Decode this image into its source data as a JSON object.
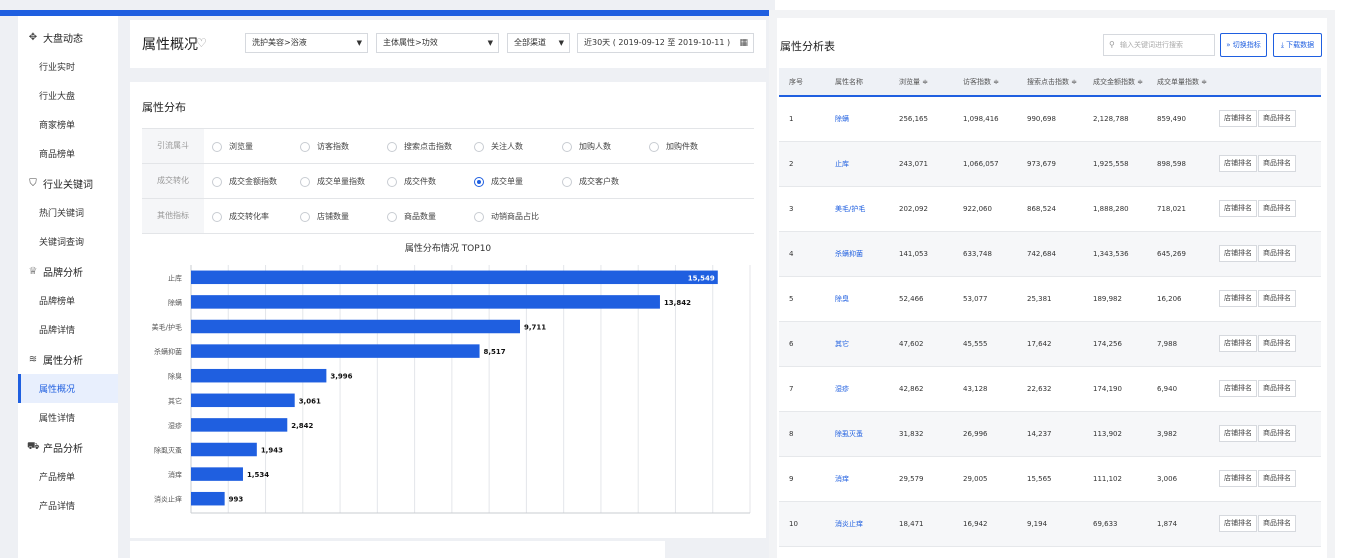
{
  "sidebar": {
    "groups": [
      {
        "label": "大盘动态",
        "icon": "pin-icon",
        "items": [
          "行业实时",
          "行业大盘",
          "商家榜单",
          "商品榜单"
        ]
      },
      {
        "label": "行业关键词",
        "icon": "shield-icon",
        "items": [
          "热门关键词",
          "关键词查询"
        ]
      },
      {
        "label": "品牌分析",
        "icon": "crown-icon",
        "items": [
          "品牌榜单",
          "品牌详情"
        ]
      },
      {
        "label": "属性分析",
        "icon": "bars-icon",
        "items": [
          "属性概况",
          "属性详情"
        ]
      },
      {
        "label": "产品分析",
        "icon": "cart-icon",
        "items": [
          "产品榜单",
          "产品详情"
        ]
      }
    ],
    "active_item": "属性概况"
  },
  "header": {
    "title": "属性概况",
    "category_select": "洗护美容>浴液",
    "attribute_select": "主体属性>功效",
    "channel_select": "全部渠道",
    "date_range": "近30天 ( 2019-09-12 至 2019-10-11 )"
  },
  "distribution": {
    "title": "属性分布",
    "rows": [
      {
        "label": "引流属斗",
        "options": [
          "浏览量",
          "访客指数",
          "搜索点击指数",
          "关注人数",
          "加购人数",
          "加购件数"
        ]
      },
      {
        "label": "成交转化",
        "options": [
          "成交金额指数",
          "成交单量指数",
          "成交件数",
          "成交单量",
          "成交客户数"
        ]
      },
      {
        "label": "其他指标",
        "options": [
          "成交转化率",
          "店铺数量",
          "商品数量",
          "动销商品占比"
        ]
      }
    ],
    "selected": "成交单量"
  },
  "chart_data": {
    "type": "bar",
    "orientation": "horizontal",
    "title": "属性分布情况 TOP10",
    "categories": [
      "止库",
      "除螨",
      "美毛/护毛",
      "杀螨抑菌",
      "除臭",
      "其它",
      "湿疹",
      "除虱灭蚤",
      "消痒",
      "消炎止痒"
    ],
    "values": [
      15549,
      13842,
      9711,
      8517,
      3996,
      3061,
      2842,
      1943,
      1534,
      993
    ],
    "value_labels": [
      "15,549",
      "13,842",
      "9,711",
      "8,517",
      "3,996",
      "3,061",
      "2,842",
      "1,943",
      "1,534",
      "993"
    ],
    "xlim": [
      0,
      16500
    ],
    "grid": true,
    "bar_color": "#1f5fe0"
  },
  "table": {
    "title": "属性分析表",
    "search_placeholder": "输入关键词进行搜索",
    "switch_button": "切换指标",
    "download_button": "下载数据",
    "columns": [
      "序号",
      "属性名称",
      "浏览量 ≑",
      "访客指数 ≑",
      "搜索点击指数 ≑",
      "成交金额指数 ≑",
      "成交单量指数 ≑",
      ""
    ],
    "rows": [
      [
        "1",
        "除螨",
        "256,165",
        "1,098,416",
        "990,698",
        "2,128,788",
        "859,490"
      ],
      [
        "2",
        "止库",
        "243,071",
        "1,066,057",
        "973,679",
        "1,925,558",
        "898,598"
      ],
      [
        "3",
        "美毛/护毛",
        "202,092",
        "922,060",
        "868,524",
        "1,888,280",
        "718,021"
      ],
      [
        "4",
        "杀螨抑菌",
        "141,053",
        "633,748",
        "742,684",
        "1,343,536",
        "645,269"
      ],
      [
        "5",
        "除臭",
        "52,466",
        "53,077",
        "25,381",
        "189,982",
        "16,206"
      ],
      [
        "6",
        "其它",
        "47,602",
        "45,555",
        "17,642",
        "174,256",
        "7,988"
      ],
      [
        "7",
        "湿疹",
        "42,862",
        "43,128",
        "22,632",
        "174,190",
        "6,940"
      ],
      [
        "8",
        "除虱灭蚤",
        "31,832",
        "26,996",
        "14,237",
        "113,902",
        "3,982"
      ],
      [
        "9",
        "消痒",
        "29,579",
        "29,005",
        "15,565",
        "111,102",
        "3,006"
      ],
      [
        "10",
        "消炎止痒",
        "18,471",
        "16,942",
        "9,194",
        "69,633",
        "1,874"
      ]
    ],
    "row_buttons": [
      "店铺排名",
      "商品排名"
    ]
  },
  "colors": {
    "accent": "#1f5fe0",
    "sidebar_active_bg": "#e8effd"
  }
}
